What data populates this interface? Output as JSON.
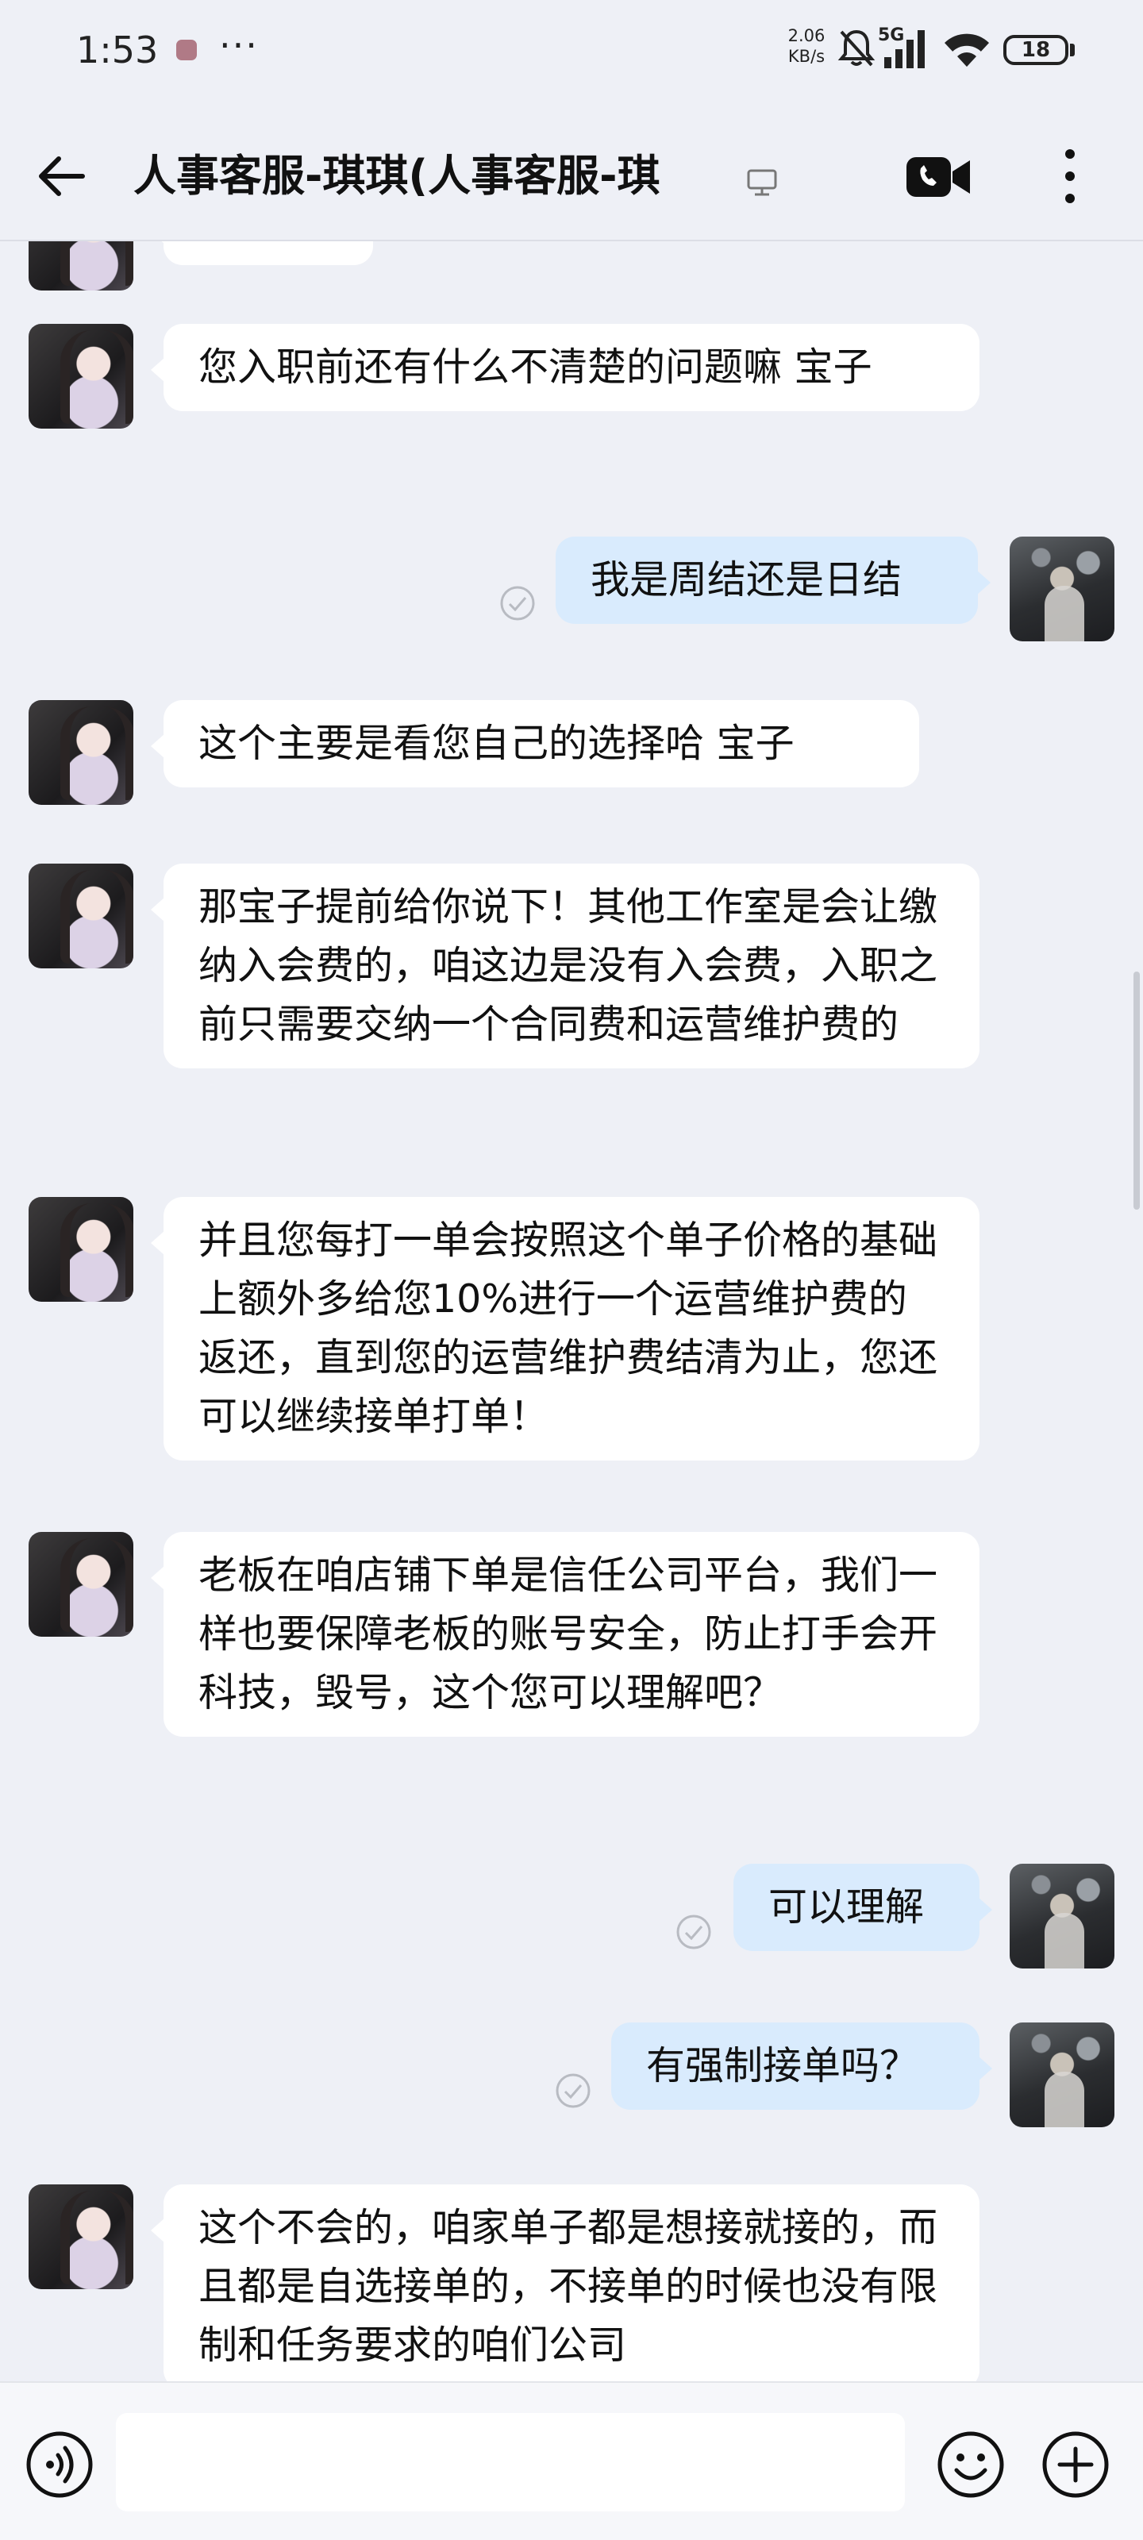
{
  "status_bar": {
    "time": "1:53",
    "dots": "···",
    "net_speed": "2.06 KB/s",
    "network": "5G",
    "battery": "18"
  },
  "header": {
    "title": "人事客服-琪琪(人事客服-琪"
  },
  "messages": [
    {
      "sender": "agent",
      "text": ""
    },
    {
      "sender": "agent",
      "text": "您入职前还有什么不清楚的问题嘛  宝子"
    },
    {
      "sender": "user",
      "text": "我是周结还是日结"
    },
    {
      "sender": "agent",
      "text": "这个主要是看您自己的选择哈 宝子"
    },
    {
      "sender": "agent",
      "text": "那宝子提前给你说下！其他工作室是会让缴纳入会费的，咱这边是没有入会费，入职之前只需要交纳一个合同费和运营维护费的"
    },
    {
      "sender": "agent",
      "text": "并且您每打一单会按照这个单子价格的基础上额外多给您10%进行一个运营维护费的返还，直到您的运营维护费结清为止，您还可以继续接单打单！"
    },
    {
      "sender": "agent",
      "text": "老板在咱店铺下单是信任公司平台，我们一样也要保障老板的账号安全，防止打手会开科技，毁号，这个您可以理解吧？"
    },
    {
      "sender": "user",
      "text": "可以理解"
    },
    {
      "sender": "user",
      "text": "有强制接单吗？"
    },
    {
      "sender": "agent",
      "text": "这个不会的，咱家单子都是想接就接的，而且都是自选接单的，不接单的时候也没有限制和任务要求的咱们公司"
    }
  ],
  "input": {
    "placeholder": ""
  },
  "colors": {
    "background": "#eef0f6",
    "incoming_bubble": "#ffffff",
    "outgoing_bubble": "#d9ebfd"
  },
  "icons": [
    "back-arrow-icon",
    "monitor-icon",
    "video-call-icon",
    "more-vertical-icon",
    "read-check-icon",
    "voice-icon",
    "emoji-icon",
    "add-icon"
  ]
}
